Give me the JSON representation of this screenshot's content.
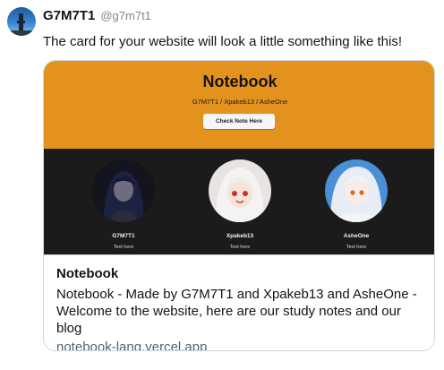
{
  "user": {
    "display_name": "G7M7T1",
    "handle": "@g7m7t1"
  },
  "tweet": {
    "text": "The card for your website will look a little something like this!"
  },
  "preview": {
    "title": "Notebook",
    "subtitle": "G7M7T1 / Xpakeb13 / AsheOne",
    "button_label": "Check Note Here",
    "accent_color": "#e4921e",
    "members": [
      {
        "name": "G7M7T1",
        "text": "Text here"
      },
      {
        "name": "Xpakeb13",
        "text": "Text here"
      },
      {
        "name": "AsheOne",
        "text": "Text here"
      }
    ]
  },
  "card": {
    "title": "Notebook",
    "description": "Notebook - Made by G7M7T1 and Xpakeb13 and AsheOne - Welcome to the website, here are our study notes and our blog",
    "domain": "notebook-lang.vercel.app"
  }
}
